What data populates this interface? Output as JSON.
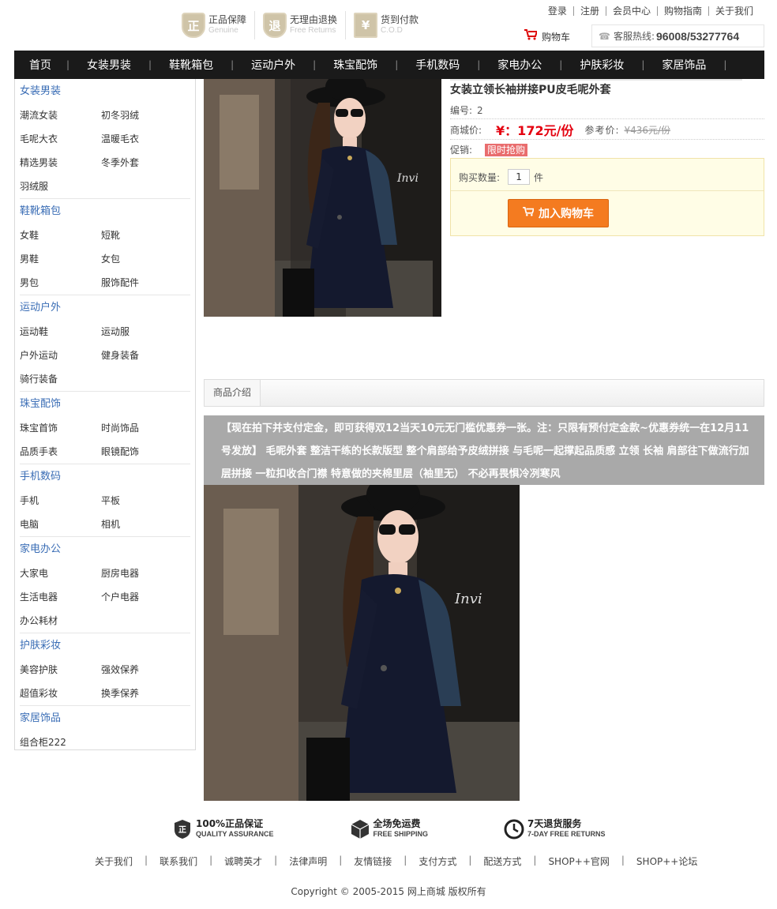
{
  "header": {
    "guarantees": [
      {
        "icon": "正",
        "title": "正品保障",
        "sub": "Genuine"
      },
      {
        "icon": "退",
        "title": "无理由退换",
        "sub": "Free Returns"
      },
      {
        "icon": "¥",
        "title": "货到付款",
        "sub": "C.O.D"
      }
    ],
    "top_links": [
      "登录",
      "注册",
      "会员中心",
      "购物指南",
      "关于我们"
    ],
    "cart_label": "购物车",
    "hotline_label": "客服热线:",
    "hotline_number": "96008/53277764"
  },
  "nav": [
    "首页",
    "女装男装",
    "鞋靴箱包",
    "运动户外",
    "珠宝配饰",
    "手机数码",
    "家电办公",
    "护肤彩妆",
    "家居饰品"
  ],
  "sidebar": [
    {
      "title": "女装男装",
      "items": [
        "潮流女装",
        "初冬羽绒",
        "毛呢大衣",
        "温暖毛衣",
        "精选男装",
        "冬季外套",
        "羽绒服"
      ]
    },
    {
      "title": "鞋靴箱包",
      "items": [
        "女鞋",
        "短靴",
        "男鞋",
        "女包",
        "男包",
        "服饰配件"
      ]
    },
    {
      "title": "运动户外",
      "items": [
        "运动鞋",
        "运动服",
        "户外运动",
        "健身装备",
        "骑行装备"
      ]
    },
    {
      "title": "珠宝配饰",
      "items": [
        "珠宝首饰",
        "时尚饰品",
        "品质手表",
        "眼镜配饰"
      ]
    },
    {
      "title": "手机数码",
      "items": [
        "手机",
        "平板",
        "电脑",
        "相机"
      ]
    },
    {
      "title": "家电办公",
      "items": [
        "大家电",
        "厨房电器",
        "生活电器",
        "个户电器",
        "办公耗材"
      ]
    },
    {
      "title": "护肤彩妆",
      "items": [
        "美容护肤",
        "强效保养",
        "超值彩妆",
        "换季保养"
      ]
    },
    {
      "title": "家居饰品",
      "items": [
        "组合柜222"
      ]
    }
  ],
  "product": {
    "title": "女装立领长袖拼接PU皮毛呢外套",
    "code_label": "编号:",
    "code": "2",
    "price_label": "商城价:",
    "price": "¥：172元/份",
    "ref_label": "参考价:",
    "ref_price": "¥436元/份",
    "promo_label": "促销:",
    "promo_tag": "限时抢购",
    "qty_label": "购买数量:",
    "qty_value": "1",
    "qty_unit": "件",
    "add_to_cart": "加入购物车"
  },
  "tabs": [
    "商品介绍"
  ],
  "description": "【现在拍下并支付定金，即可获得双12当天10元无门槛优惠券一张。注：只限有预付定金款~优惠券统一在12月11号发放】 毛呢外套 整洁干练的长款版型 整个肩部给予皮绒拼接 与毛呢一起撑起品质感 立领 长袖 肩部往下做流行加层拼接 一粒扣收合门襟 特意做的夹棉里层（袖里无） 不必再畏惧冷冽寒风",
  "footer": {
    "promises": [
      {
        "icon": "shield-icon",
        "title": "100%正品保证",
        "sub": "QUALITY ASSURANCE"
      },
      {
        "icon": "box-icon",
        "title": "全场免运费",
        "sub": "FREE SHIPPING"
      },
      {
        "icon": "clock-icon",
        "title": "7天退货服务",
        "sub": "7-DAY FREE RETURNS"
      }
    ],
    "links": [
      "关于我们",
      "联系我们",
      "诚聘英才",
      "法律声明",
      "友情链接",
      "支付方式",
      "配送方式",
      "SHOP++官网",
      "SHOP++论坛"
    ],
    "copyright": "Copyright © 2005-2015 网上商城 版权所有"
  }
}
